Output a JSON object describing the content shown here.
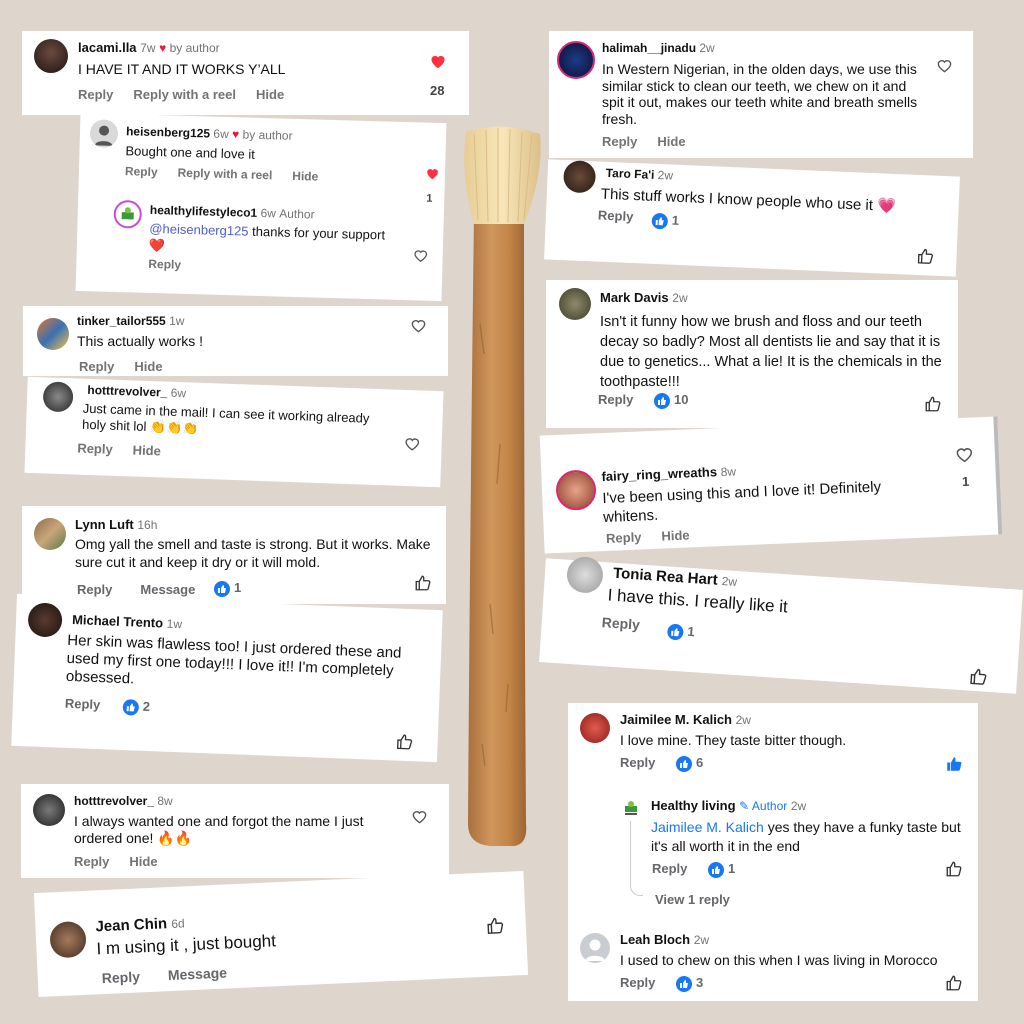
{
  "colors": {
    "background": "#ded5cd",
    "like_blue": "#1877f2",
    "heart_red": "#ff3040",
    "stick": "#c9874c",
    "bristles": "#f2dca6"
  },
  "c1": {
    "user": "lacami.lla",
    "time": "7w",
    "by": "by author",
    "text": "I HAVE IT AND IT WORKS Y’ALL",
    "a1": "Reply",
    "a2": "Reply with a reel",
    "a3": "Hide",
    "count": "28"
  },
  "c2": {
    "user": "heisenberg125",
    "time": "6w",
    "by": "by author",
    "text": "Bought one and love it",
    "a1": "Reply",
    "a2": "Reply with a reel",
    "a3": "Hide",
    "count": "1"
  },
  "c3": {
    "user": "healthylifestyleco1",
    "time": "6w",
    "role": "Author",
    "mention": "@heisenberg125",
    "text": " thanks for your support",
    "a1": "Reply"
  },
  "c4": {
    "user": "tinker_tailor555",
    "time": "1w",
    "text": "This actually works !",
    "a1": "Reply",
    "a2": "Hide"
  },
  "c5": {
    "user": "hotttrevolver_",
    "time": "6w",
    "text": "Just came in the mail! I can see it working already holy shit lol 👏👏👏",
    "a1": "Reply",
    "a2": "Hide"
  },
  "c6": {
    "user": "Lynn Luft",
    "time": "16h",
    "text": "Omg yall the smell and taste is strong. But it works. Make sure cut it and keep it dry or it will mold.",
    "a1": "Reply",
    "a2": "Message",
    "likes": "1"
  },
  "c7": {
    "user": "Michael Trento",
    "time": "1w",
    "text": "Her skin was flawless too!  I just ordered these and used my first one today!!! I love it!! I'm completely obsessed.",
    "a1": "Reply",
    "likes": "2"
  },
  "c8": {
    "user": "hotttrevolver_",
    "time": "8w",
    "text": "I always wanted one and forgot the name I just ordered one! 🔥🔥",
    "a1": "Reply",
    "a2": "Hide"
  },
  "c9": {
    "user": "Jean Chin",
    "time": "6d",
    "text": "I m using it , just bought",
    "a1": "Reply",
    "a2": "Message"
  },
  "c10": {
    "user": "halimah__jinadu",
    "time": "2w",
    "text": "In Western Nigerian, in the olden days, we use this similar stick to clean our teeth, we chew on it and spit it out, makes our teeth white and breath smells fresh.",
    "a1": "Reply",
    "a2": "Hide"
  },
  "c11": {
    "user": "Taro Fa'i",
    "time": "2w",
    "text": "This stuff works I know people who use it 💗",
    "a1": "Reply",
    "likes": "1"
  },
  "c12": {
    "user": "Mark Davis",
    "time": "2w",
    "text": "Isn't it funny how we brush and floss and our teeth decay so badly? Most all dentists lie and say that it is due to genetics... What a lie! It is the chemicals in the toothpaste!!!",
    "a1": "Reply",
    "likes": "10"
  },
  "c13": {
    "user": "fairy_ring_wreaths",
    "time": "8w",
    "text": "I've been using this and I love it! Definitely whitens.",
    "a1": "Reply",
    "a2": "Hide",
    "count": "1"
  },
  "c14": {
    "user": "Tonia Rea Hart",
    "time": "2w",
    "text": "I have this. I really like it",
    "a1": "Reply",
    "likes": "1"
  },
  "c15": {
    "user": "Jaimilee M. Kalich",
    "time": "2w",
    "text": "I love mine.  They taste bitter though.",
    "a1": "Reply",
    "likes": "6"
  },
  "c16": {
    "user": "Healthy living",
    "role": "Author",
    "time": "2w",
    "mention": "Jaimilee M. Kalich",
    "text": " yes they have a funky taste but it's all worth it in the end",
    "a1": "Reply",
    "likes": "1",
    "view": "View 1 reply"
  },
  "c17": {
    "user": "Leah Bloch",
    "time": "2w",
    "text": "I used to chew on this when I was living in Morocco",
    "a1": "Reply",
    "likes": "3"
  }
}
